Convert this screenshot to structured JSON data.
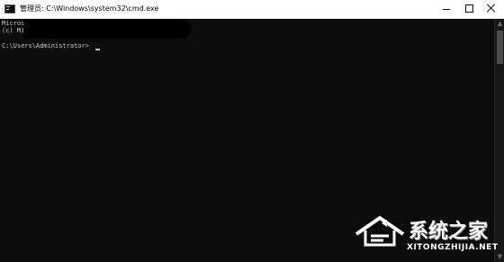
{
  "window": {
    "title": "管理员: C:\\Windows\\system32\\cmd.exe",
    "controls": {
      "minimize": "minimize",
      "maximize": "maximize",
      "close": "close"
    }
  },
  "console": {
    "lines": [
      "Microsoft Wi",
      "(c) Mi",
      "C:\\Users\\Administrator>"
    ],
    "text_color": "#c8c8c8",
    "background": "#0c0c0c"
  },
  "watermark": {
    "brand_cn": "系统之家",
    "brand_en": "XITONGZHIJIA.NET"
  }
}
